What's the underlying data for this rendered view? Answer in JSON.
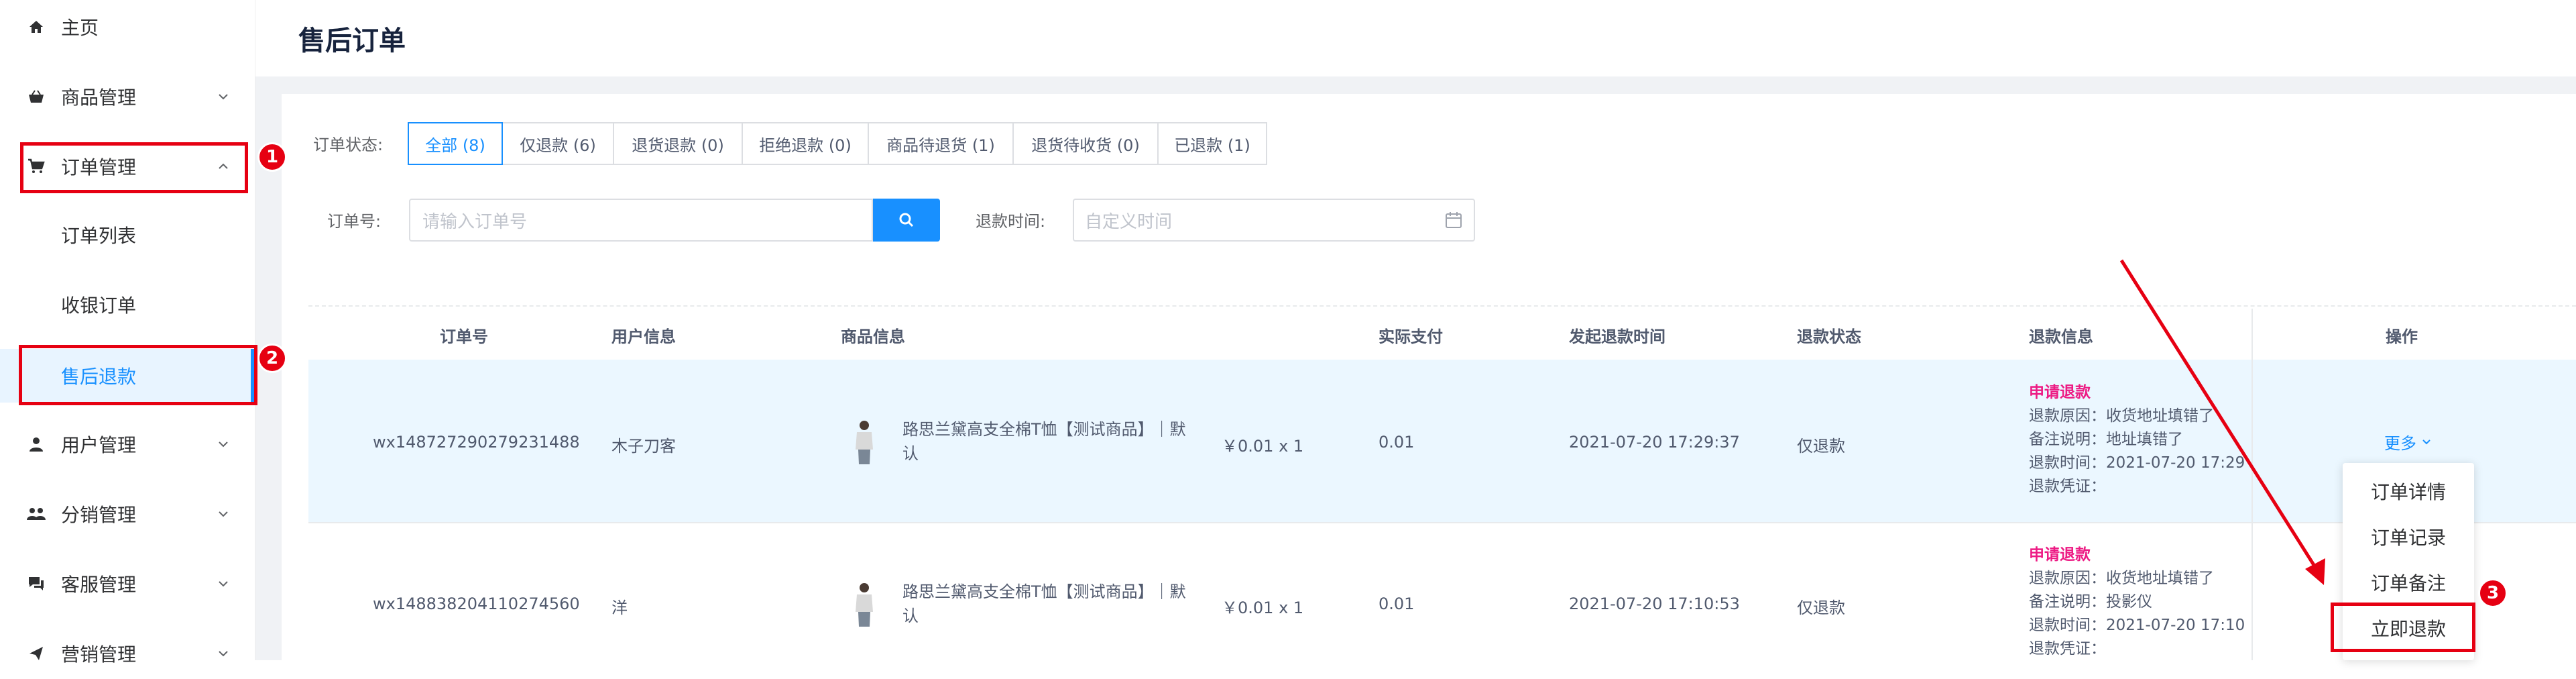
{
  "sidebar": {
    "items": [
      {
        "label": "主页",
        "icon": "home-icon"
      },
      {
        "label": "商品管理",
        "icon": "basket-icon"
      },
      {
        "label": "订单管理",
        "icon": "cart-icon"
      },
      {
        "label": "订单列表"
      },
      {
        "label": "收银订单"
      },
      {
        "label": "售后退款"
      },
      {
        "label": "用户管理",
        "icon": "user-icon"
      },
      {
        "label": "分销管理",
        "icon": "users-icon"
      },
      {
        "label": "客服管理",
        "icon": "chat-icon"
      },
      {
        "label": "营销管理",
        "icon": "send-icon"
      }
    ]
  },
  "badges": [
    "1",
    "2",
    "3"
  ],
  "header": {
    "title": "售后订单"
  },
  "filters": {
    "status_label": "订单状态:",
    "tabs": [
      "全部 (8)",
      "仅退款 (6)",
      "退货退款 (0)",
      "拒绝退款 (0)",
      "商品待退货 (1)",
      "退货待收货 (0)",
      "已退款 (1)"
    ],
    "active_tab": 0,
    "order_label": "订单号:",
    "order_placeholder": "请输入订单号",
    "refund_time_label": "退款时间:",
    "date_placeholder": "自定义时间"
  },
  "table": {
    "headers": [
      "订单号",
      "用户信息",
      "商品信息",
      "实际支付",
      "发起退款时间",
      "退款状态",
      "退款信息",
      "操作"
    ],
    "rows": [
      {
        "order_no": "wx148727290279231488",
        "user": "木子刀客",
        "goods_line1": "路思兰黛高支全棉T恤【测试商品】｜默",
        "goods_line2": "认",
        "price_qty": "￥0.01 x 1",
        "paid": "0.01",
        "refund_time": "2021-07-20 17:29:37",
        "refund_status": "仅退款",
        "info_status": "申请退款",
        "info_reason": "退款原因：收货地址填错了",
        "info_note": "备注说明：地址填错了",
        "info_time": "退款时间：2021-07-20 17:29",
        "info_proof": "退款凭证："
      },
      {
        "order_no": "wx148838204110274560",
        "user": "洋",
        "goods_line1": "路思兰黛高支全棉T恤【测试商品】｜默",
        "goods_line2": "认",
        "price_qty": "￥0.01 x 1",
        "paid": "0.01",
        "refund_time": "2021-07-20 17:10:53",
        "refund_status": "仅退款",
        "info_status": "申请退款",
        "info_reason": "退款原因：收货地址填错了",
        "info_note": "备注说明：投影仪",
        "info_time": "退款时间：2021-07-20 17:10",
        "info_proof": "退款凭证："
      }
    ]
  },
  "actions": {
    "more_label": "更多",
    "menu": [
      "订单详情",
      "订单记录",
      "订单备注",
      "立即退款"
    ]
  },
  "colors": {
    "accent": "#1890ff",
    "annotation": "#e60012",
    "refund_status": "#ed1b84"
  }
}
